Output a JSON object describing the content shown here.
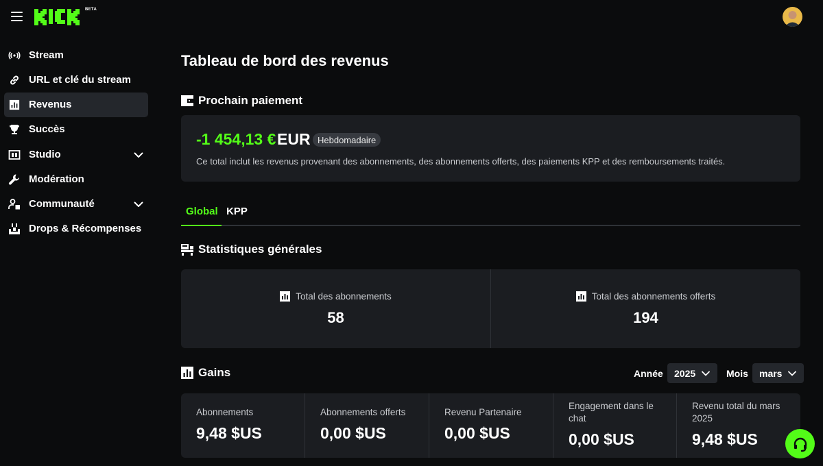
{
  "app": {
    "logo_text": "KICK",
    "logo_badge": "BETA",
    "accent_color": "#53fc18"
  },
  "sidebar": {
    "items": [
      {
        "label": "Stream",
        "icon": "broadcast-icon"
      },
      {
        "label": "URL et clé du stream",
        "icon": "link-icon"
      },
      {
        "label": "Revenus",
        "icon": "bar-chart-icon",
        "active": true
      },
      {
        "label": "Succès",
        "icon": "trophy-icon"
      },
      {
        "label": "Studio",
        "icon": "studio-icon",
        "expandable": true
      },
      {
        "label": "Modération",
        "icon": "wrench-icon"
      },
      {
        "label": "Communauté",
        "icon": "community-icon",
        "expandable": true
      },
      {
        "label": "Drops & Récompenses",
        "icon": "gift-icon"
      }
    ]
  },
  "main": {
    "title": "Tableau de bord des revenus",
    "payout": {
      "section_title": "Prochain paiement",
      "amount": "-1 454,13 €",
      "currency": "EUR",
      "frequency_badge": "Hebdomadaire",
      "description": "Ce total inclut les revenus provenant des abonnements, des abonnements offerts, des paiements KPP et des remboursements traités."
    },
    "tabs": [
      {
        "label": "Global",
        "active": true
      },
      {
        "label": "KPP",
        "active": false
      }
    ],
    "stats": {
      "section_title": "Statistiques générales",
      "items": [
        {
          "label": "Total des abonnements",
          "value": "58"
        },
        {
          "label": "Total des abonnements offerts",
          "value": "194"
        }
      ]
    },
    "earnings": {
      "section_title": "Gains",
      "year_label": "Année",
      "year_value": "2025",
      "month_label": "Mois",
      "month_value": "mars",
      "items": [
        {
          "label": "Abonnements",
          "value": "9,48 $US"
        },
        {
          "label": "Abonnements offerts",
          "value": "0,00 $US"
        },
        {
          "label": "Revenu Partenaire",
          "value": "0,00 $US"
        },
        {
          "label": "Engagement dans le chat",
          "value": "0,00 $US"
        },
        {
          "label": "Revenu total du mars 2025",
          "value": "9,48 $US"
        }
      ]
    }
  }
}
